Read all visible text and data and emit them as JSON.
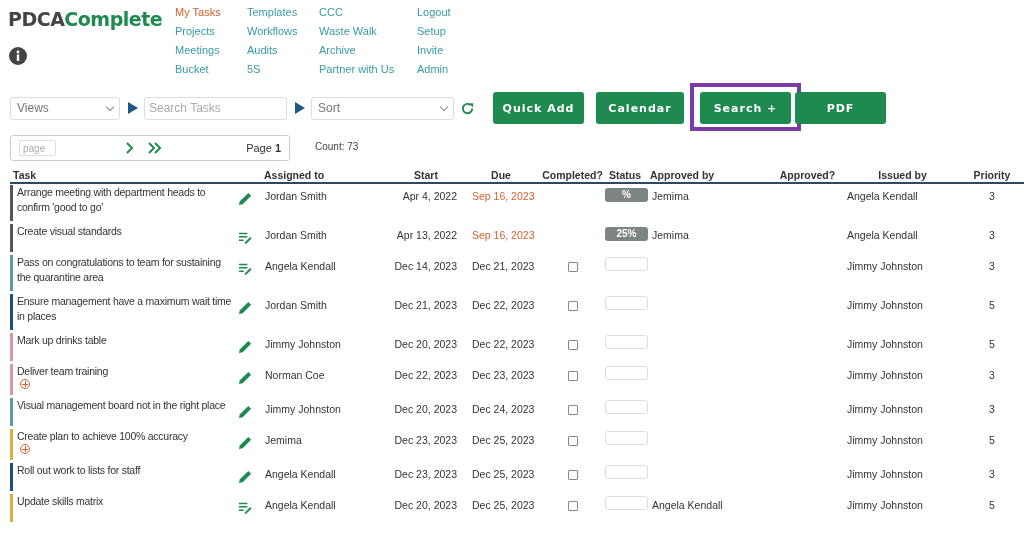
{
  "logo": {
    "part_1": "PDCA",
    "part_2": "Complete"
  },
  "nav": [
    [
      {
        "label": "My Tasks",
        "selected": true
      },
      {
        "label": "Projects",
        "selected": false
      },
      {
        "label": "Meetings",
        "selected": false
      },
      {
        "label": "Bucket",
        "selected": false
      }
    ],
    [
      {
        "label": "Templates",
        "selected": false
      },
      {
        "label": "Workflows",
        "selected": false
      },
      {
        "label": "Audits",
        "selected": false
      },
      {
        "label": "5S",
        "selected": false
      }
    ],
    [
      {
        "label": "CCC",
        "selected": false
      },
      {
        "label": "Waste Walk",
        "selected": false
      },
      {
        "label": "Archive",
        "selected": false
      },
      {
        "label": "Partner with Us",
        "selected": false
      }
    ],
    [
      {
        "label": "Logout",
        "selected": false
      },
      {
        "label": "Setup",
        "selected": false
      },
      {
        "label": "Invite",
        "selected": false
      },
      {
        "label": "Admin",
        "selected": false
      }
    ]
  ],
  "toolbar": {
    "views": "Views",
    "search_placeholder": "Search Tasks",
    "sort": "Sort",
    "buttons": [
      {
        "label": "Quick Add",
        "highlighted": false
      },
      {
        "label": "Calendar",
        "highlighted": false
      },
      {
        "label": "Search +",
        "highlighted": true
      },
      {
        "label": "PDF",
        "highlighted": false
      }
    ]
  },
  "pager": {
    "placeholder": "page",
    "page_label": "Page",
    "page_number": "1",
    "count": "Count: 73"
  },
  "table": {
    "columns": [
      "Task",
      "Assigned to",
      "Start",
      "Due",
      "Completed?",
      "Status",
      "Approved by",
      "Approved?",
      "Issued by",
      "Priority"
    ],
    "rows": [
      {
        "task": "Arrange meeting with department heads to confirm 'good to go'",
        "color": "#555555",
        "kind": "pencil",
        "subtask": false,
        "assigned": "Jordan Smith",
        "start": "Apr 4, 2022",
        "due": "Sep 16, 2023",
        "overdue": true,
        "status": "%",
        "approved_by": "Jemima",
        "issued_by": "Angela Kendall",
        "priority": "3"
      },
      {
        "task": "Create visual standards",
        "color": "#555555",
        "kind": "notes",
        "subtask": false,
        "assigned": "Jordan Smith",
        "start": "Apr 13, 2022",
        "due": "Sep 16, 2023",
        "overdue": true,
        "status": "25%",
        "approved_by": "Jemima",
        "issued_by": "Angela Kendall",
        "priority": "3"
      },
      {
        "task": "Pass on congratulations to team for sustaining the quarantine area",
        "color": "#5a9e9b",
        "kind": "notes",
        "subtask": false,
        "assigned": "Angela Kendall",
        "start": "Dec 14, 2023",
        "due": "Dec 21, 2023",
        "overdue": false,
        "completed": false,
        "issued_by": "Jimmy Johnston",
        "priority": "3"
      },
      {
        "task": "Ensure management have a maximum wait time in places",
        "color": "#1b4f8a",
        "kind": "pencil",
        "subtask": false,
        "assigned": "Jordan Smith",
        "start": "Dec 21, 2023",
        "due": "Dec 22, 2023",
        "overdue": false,
        "completed": false,
        "issued_by": "Jimmy Johnston",
        "priority": "5"
      },
      {
        "task": "Mark up drinks table",
        "color": "#e0959e",
        "kind": "pencil",
        "subtask": false,
        "assigned": "Jimmy Johnston",
        "start": "Dec 20, 2023",
        "due": "Dec 22, 2023",
        "overdue": false,
        "completed": false,
        "issued_by": "Jimmy Johnston",
        "priority": "5"
      },
      {
        "task": "Deliver team training",
        "color": "#e0959e",
        "kind": "pencil",
        "subtask": true,
        "assigned": "Norman Coe",
        "start": "Dec 22, 2023",
        "due": "Dec 23, 2023",
        "overdue": false,
        "completed": false,
        "issued_by": "Jimmy Johnston",
        "priority": "3"
      },
      {
        "task": "Visual management board not in the right place",
        "color": "#5a9e9b",
        "kind": "pencil",
        "subtask": false,
        "assigned": "Jimmy Johnston",
        "start": "Dec 20, 2023",
        "due": "Dec 24, 2023",
        "overdue": false,
        "completed": false,
        "issued_by": "Jimmy Johnston",
        "priority": "3"
      },
      {
        "task": "Create plan to achieve 100% accuracy",
        "color": "#d9b13b",
        "kind": "pencil",
        "subtask": true,
        "assigned": "Jemima",
        "start": "Dec 23, 2023",
        "due": "Dec 25, 2023",
        "overdue": false,
        "completed": false,
        "issued_by": "Jimmy Johnston",
        "priority": "5"
      },
      {
        "task": "Roll out work to lists for staff",
        "color": "#1b4f8a",
        "kind": "pencil",
        "subtask": false,
        "assigned": "Angela Kendall",
        "start": "Dec 23, 2023",
        "due": "Dec 25, 2023",
        "overdue": false,
        "completed": false,
        "issued_by": "Jimmy Johnston",
        "priority": "3"
      },
      {
        "task": "Update skills matrix",
        "color": "#d9b13b",
        "kind": "notes",
        "subtask": false,
        "assigned": "Angela Kendall",
        "start": "Dec 20, 2023",
        "due": "Dec 25, 2023",
        "overdue": false,
        "completed": false,
        "approved_by": "Angela Kendall",
        "issued_by": "Jimmy Johnston",
        "priority": "5"
      }
    ]
  }
}
